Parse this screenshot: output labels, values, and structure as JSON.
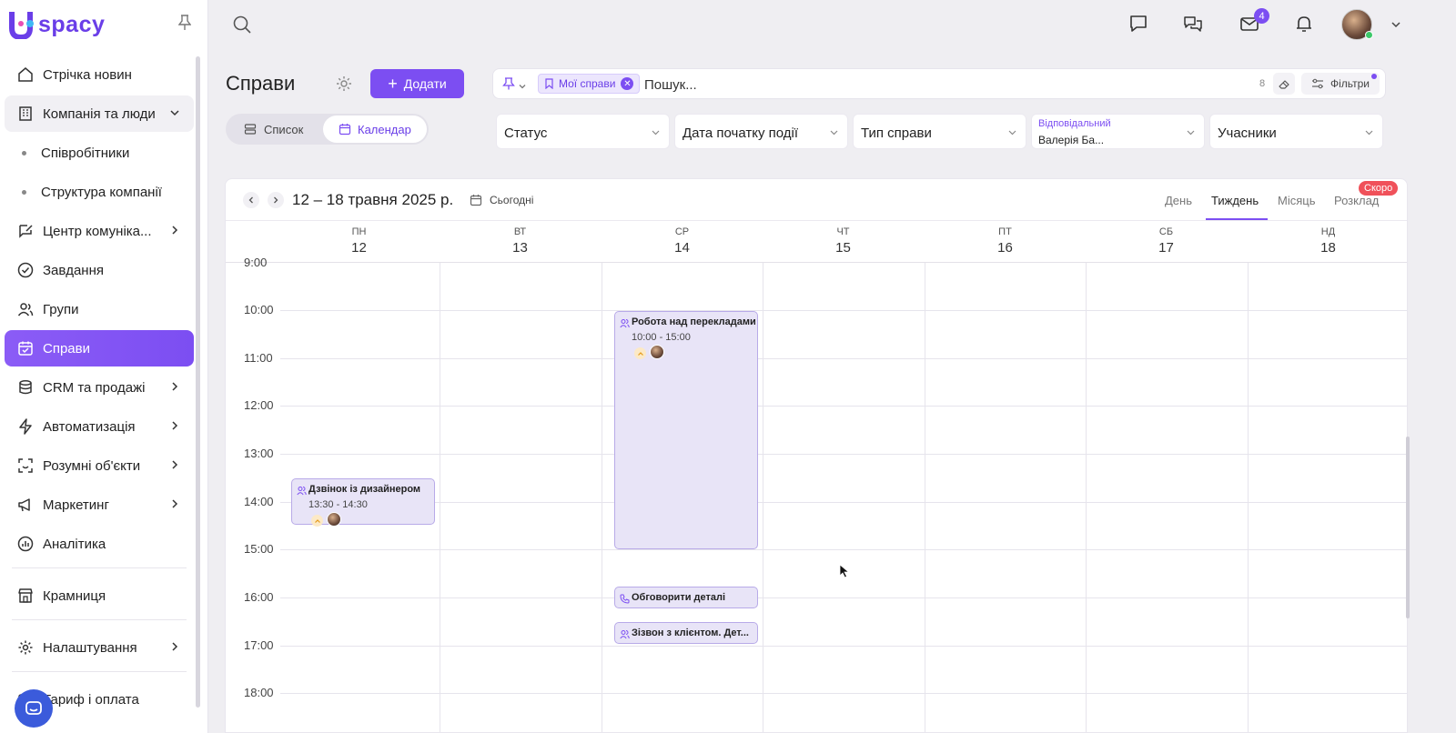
{
  "brand": {
    "name": "spacy"
  },
  "sidebar": {
    "items": [
      {
        "label": "Стрічка новин",
        "icon": "home-icon"
      },
      {
        "label": "Компанія та люди",
        "icon": "building-icon",
        "expanded": true
      },
      {
        "label": "Співробітники",
        "sub": true
      },
      {
        "label": "Структура компанії",
        "sub": true
      },
      {
        "label": "Центр комуніка...",
        "icon": "chat-edit-icon",
        "chevron": true
      },
      {
        "label": "Завдання",
        "icon": "check-circle-icon"
      },
      {
        "label": "Групи",
        "icon": "users-icon"
      },
      {
        "label": "Справи",
        "icon": "calendar-check-icon",
        "active": true
      },
      {
        "label": "CRM та продажі",
        "icon": "database-icon",
        "chevron": true
      },
      {
        "label": "Автоматизація",
        "icon": "lightning-icon",
        "chevron": true
      },
      {
        "label": "Розумні об'єкти",
        "icon": "scan-icon",
        "chevron": true
      },
      {
        "label": "Маркетинг",
        "icon": "megaphone-icon",
        "chevron": true
      },
      {
        "label": "Аналітика",
        "icon": "chart-icon"
      },
      {
        "label": "Крамниця",
        "icon": "store-icon"
      },
      {
        "label": "Налаштування",
        "icon": "gear-icon",
        "chevron": true
      },
      {
        "label": "Тариф і оплата",
        "icon": "wallet-icon"
      }
    ]
  },
  "topbar": {
    "mail_badge": "4"
  },
  "header": {
    "title": "Справи",
    "add_label": "Додати",
    "chip_label": "Мої справи",
    "search_placeholder": "Пошук...",
    "count": "8",
    "filters_label": "Фільтри"
  },
  "view_toggle": {
    "list": "Список",
    "calendar": "Календар",
    "active": "calendar"
  },
  "filters": {
    "status": "Статус",
    "start_date": "Дата початку події",
    "type": "Тип справи",
    "responsible_label": "Відповідальний",
    "responsible_value": "Валерія Ба...",
    "participants": "Учасники"
  },
  "calendar": {
    "range": "12 – 18 травня 2025 р.",
    "today": "Сьогодні",
    "modes": [
      "День",
      "Тиждень",
      "Місяць",
      "Розклад"
    ],
    "active_mode": "Тиждень",
    "soon_badge": "Скоро",
    "days": [
      {
        "name": "ПН",
        "num": "12"
      },
      {
        "name": "ВТ",
        "num": "13"
      },
      {
        "name": "СР",
        "num": "14"
      },
      {
        "name": "ЧТ",
        "num": "15"
      },
      {
        "name": "ПТ",
        "num": "16"
      },
      {
        "name": "СБ",
        "num": "17"
      },
      {
        "name": "НД",
        "num": "18"
      }
    ],
    "hours": [
      "9:00",
      "10:00",
      "11:00",
      "12:00",
      "13:00",
      "14:00",
      "15:00",
      "16:00",
      "17:00",
      "18:00"
    ],
    "events": [
      {
        "title": "Дзвінок із дизайнером",
        "time": "13:30 - 14:30",
        "day": "ПН",
        "icon": "users-icon"
      },
      {
        "title": "Робота над перекладами",
        "time": "10:00 - 15:00",
        "day": "СР",
        "icon": "users-icon"
      },
      {
        "title": "Обговорити деталі",
        "day": "СР",
        "icon": "phone-icon"
      },
      {
        "title": "Зізвон з клієнтом. Дет...",
        "day": "СР",
        "icon": "users-icon"
      }
    ]
  },
  "colors": {
    "accent": "#7c4ef2",
    "soon": "#f0515a"
  }
}
